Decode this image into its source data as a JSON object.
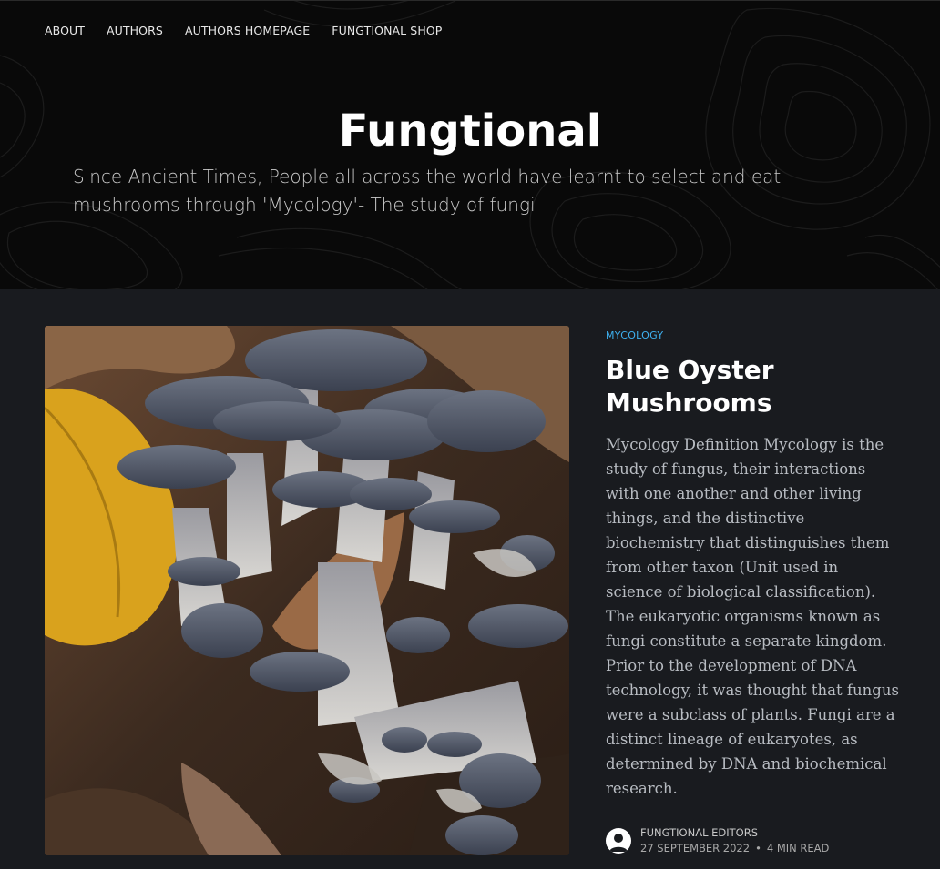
{
  "nav": {
    "items": [
      "ABOUT",
      "AUTHORS",
      "AUTHORS HOMEPAGE",
      "FUNGTIONAL SHOP"
    ]
  },
  "site": {
    "title": "Fungtional",
    "description": "Since Ancient Times, People all across the world have learnt to select and eat mushrooms through 'Mycology'- The study of fungi"
  },
  "post": {
    "tag": "MYCOLOGY",
    "title": "Blue Oyster Mushrooms",
    "excerpt": "Mycology Definition Mycology is the study of fungus, their interactions with one another and other living things, and the distinctive biochemistry that distinguishes them from other taxon (Unit used in science of biological classification). The eukaryotic organisms known as fungi constitute a separate kingdom. Prior to the development of DNA technology, it was thought that fungus were a subclass of plants. Fungi are a distinct lineage of eukaryotes, as determined by DNA and biochemical research.",
    "author": "FUNGTIONAL EDITORS",
    "date": "27 SEPTEMBER 2022",
    "separator": "•",
    "reading_time": "4 MIN READ",
    "image_icon": "blue-oyster-mushrooms-photo"
  },
  "colors": {
    "header_bg": "#090909",
    "page_bg": "#191b1f",
    "accent": "#3eb0ef"
  }
}
